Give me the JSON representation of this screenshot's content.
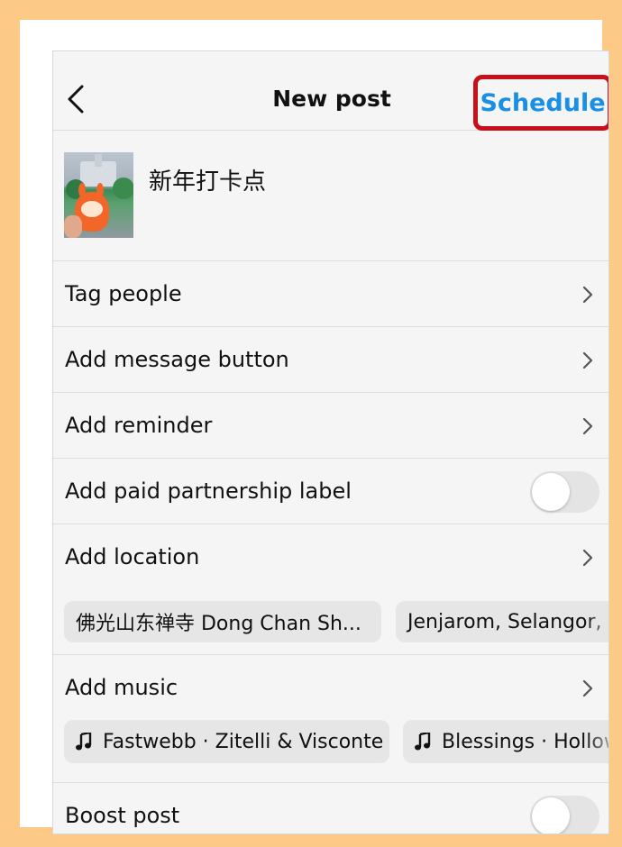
{
  "header": {
    "title": "New post",
    "schedule_label": "Schedule"
  },
  "post": {
    "caption": "新年打卡点"
  },
  "options": {
    "tag_people": "Tag people",
    "message_button": "Add message button",
    "reminder": "Add reminder",
    "paid_partnership": "Add paid partnership label",
    "location": "Add location",
    "music": "Add music",
    "boost": "Boost post"
  },
  "location_suggestions": [
    "佛光山东禅寺 Dong Chan Sh...",
    "Jenjarom, Selangor, M"
  ],
  "music_suggestions": [
    "Fastwebb · Zitelli & Visconte",
    "Blessings · Hollow"
  ],
  "toggles": {
    "paid_partnership_on": false,
    "boost_on": false
  },
  "colors": {
    "accent_blue": "#1a8fe3",
    "highlight_red": "#c8101a",
    "background_orange": "#fdc987"
  },
  "icons": [
    "back-arrow-icon",
    "chevron-right-icon",
    "music-note-icon"
  ]
}
